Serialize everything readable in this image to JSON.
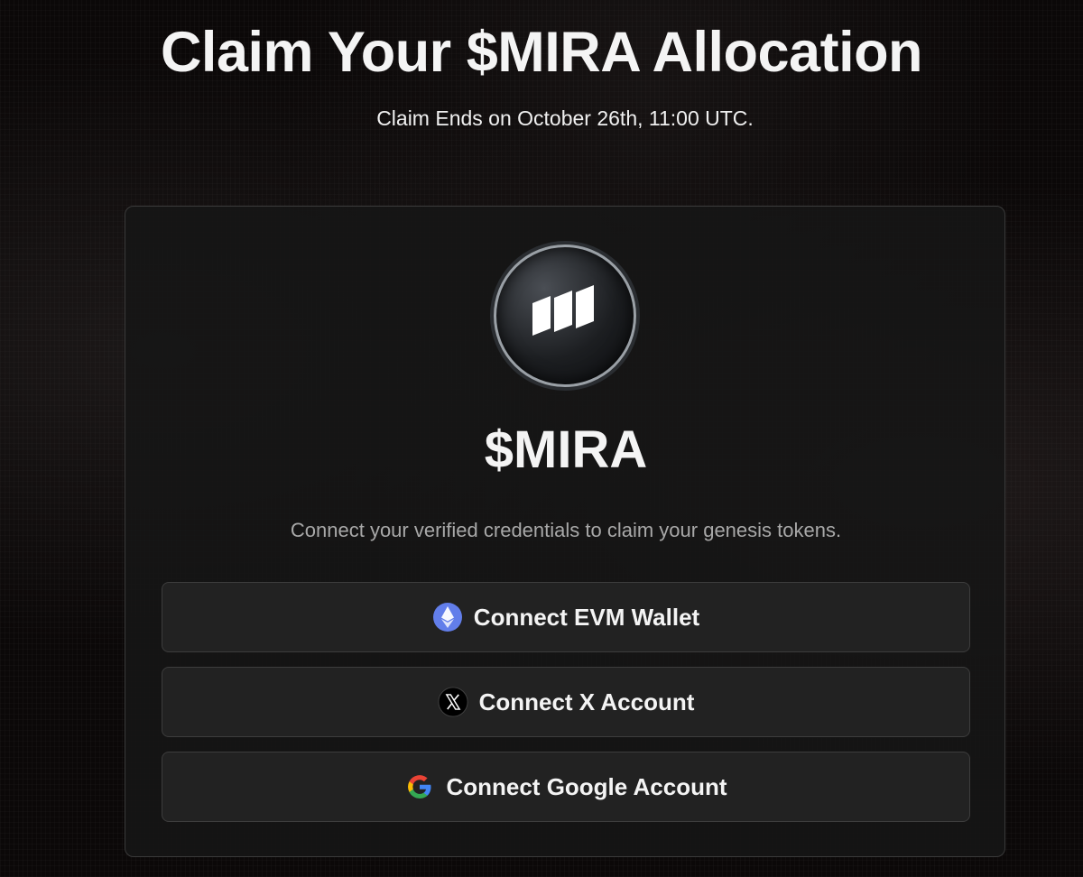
{
  "header": {
    "title": "Claim Your $MIRA Allocation",
    "subtitle": "Claim Ends on October 26th, 11:00 UTC."
  },
  "card": {
    "logo_icon": "mira-logo-icon",
    "token_name": "$MIRA",
    "description": "Connect your verified credentials to claim your genesis tokens.",
    "buttons": [
      {
        "label": "Connect EVM Wallet",
        "icon": "ethereum-icon"
      },
      {
        "label": "Connect X Account",
        "icon": "x-icon"
      },
      {
        "label": "Connect Google Account",
        "icon": "google-icon"
      }
    ]
  },
  "colors": {
    "background": "#0b0808",
    "card": "#161616",
    "button": "#222222",
    "ethereum": "#627eea"
  }
}
